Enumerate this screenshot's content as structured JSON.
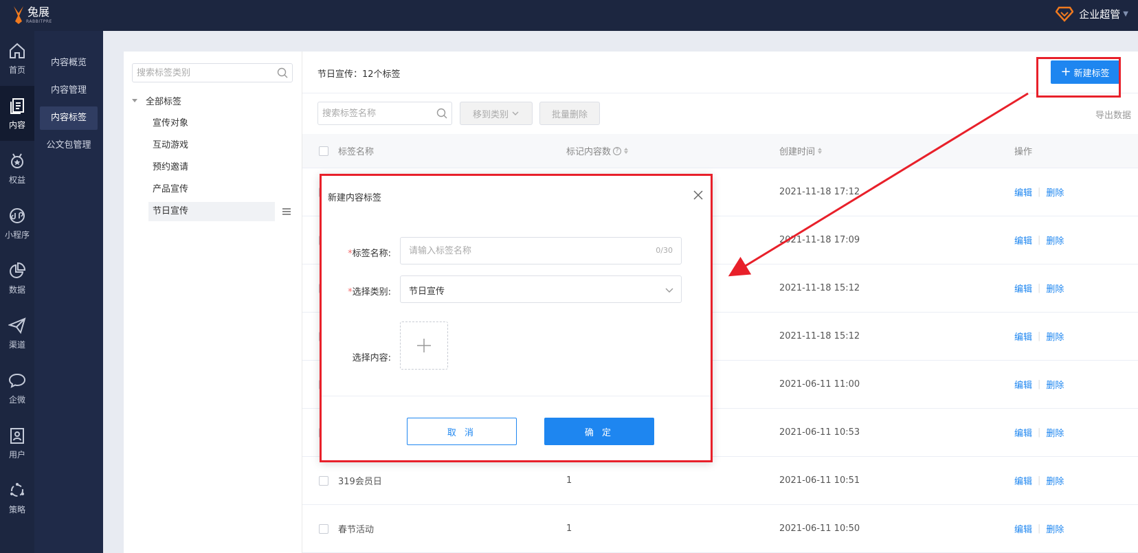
{
  "brand": {
    "name": "兔展",
    "sub": "RABBITPRE"
  },
  "user": {
    "name": "企业超管"
  },
  "rail": [
    {
      "label": "首页",
      "icon": "home-icon"
    },
    {
      "label": "内容",
      "icon": "content-icon"
    },
    {
      "label": "权益",
      "icon": "medal-icon"
    },
    {
      "label": "小程序",
      "icon": "miniprogram-icon"
    },
    {
      "label": "数据",
      "icon": "pie-chart-icon"
    },
    {
      "label": "渠道",
      "icon": "send-icon"
    },
    {
      "label": "企微",
      "icon": "chat-icon"
    },
    {
      "label": "用户",
      "icon": "user-card-icon"
    },
    {
      "label": "策略",
      "icon": "strategy-icon"
    }
  ],
  "subnav": [
    "内容概览",
    "内容管理",
    "内容标签",
    "公文包管理"
  ],
  "category": {
    "search_placeholder": "搜索标签类别",
    "root": "全部标签",
    "items": [
      "宣传对象",
      "互动游戏",
      "预约邀请",
      "产品宣传",
      "节日宣传"
    ]
  },
  "list": {
    "header_text": "节日宣传：12个标签",
    "new_button": "新建标签",
    "search_placeholder": "搜索标签名称",
    "move_button": "移到类别",
    "batch_delete": "批量删除",
    "export": "导出数据",
    "columns": {
      "name": "标签名称",
      "count": "标记内容数",
      "created": "创建时间",
      "ops": "操作"
    },
    "rows": [
      {
        "name": "",
        "count": "",
        "created": "2021-11-18 17:12"
      },
      {
        "name": "",
        "count": "",
        "created": "2021-11-18 17:09"
      },
      {
        "name": "",
        "count": "",
        "created": "2021-11-18 15:12"
      },
      {
        "name": "",
        "count": "",
        "created": "2021-11-18 15:12"
      },
      {
        "name": "",
        "count": "",
        "created": "2021-06-11 11:00"
      },
      {
        "name": "",
        "count": "",
        "created": "2021-06-11 10:53"
      },
      {
        "name": "319会员日",
        "count": "1",
        "created": "2021-06-11 10:51"
      },
      {
        "name": "春节活动",
        "count": "1",
        "created": "2021-06-11 10:50"
      }
    ],
    "edit": "编辑",
    "delete": "删除"
  },
  "dialog": {
    "title": "新建内容标签",
    "name_label": "标签名称:",
    "name_placeholder": "请输入标签名称",
    "name_counter": "0/30",
    "category_label": "选择类别:",
    "category_value": "节日宣传",
    "content_label": "选择内容:",
    "cancel": "取 消",
    "confirm": "确 定"
  },
  "colors": {
    "primary": "#1e86f0",
    "annotation": "#e8202a",
    "nav_dark": "#1c2640"
  }
}
